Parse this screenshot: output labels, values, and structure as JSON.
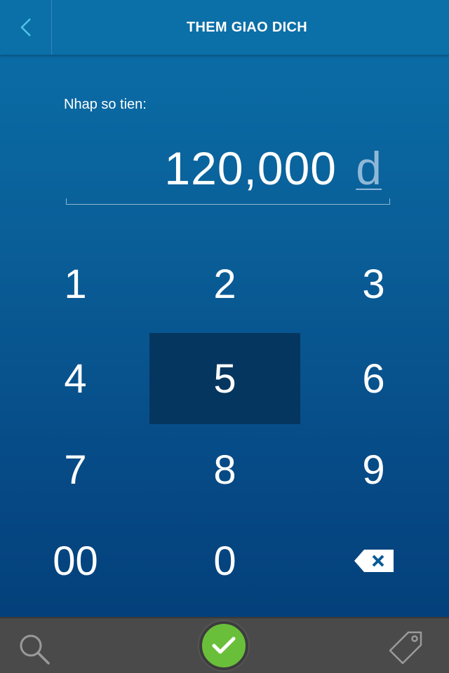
{
  "header": {
    "title": "THEM GIAO DICH",
    "back_icon": "chevron-left-icon"
  },
  "amount": {
    "prompt": "Nhap so tien:",
    "value": "120,000",
    "currency": "d"
  },
  "keypad": {
    "keys": [
      "1",
      "2",
      "3",
      "4",
      "5",
      "6",
      "7",
      "8",
      "9",
      "00",
      "0"
    ],
    "pressed_key": "5",
    "backspace_icon": "backspace-icon"
  },
  "bottom_bar": {
    "search_icon": "search-icon",
    "confirm_icon": "checkmark-icon",
    "tag_icon": "tag-icon"
  },
  "colors": {
    "header_bg": "#0b6fa8",
    "accent_back": "#4fc3e8",
    "pressed_key_bg": "#05365f",
    "confirm_green": "#6abf3a",
    "bottom_bar_bg": "#4a4a4a"
  }
}
